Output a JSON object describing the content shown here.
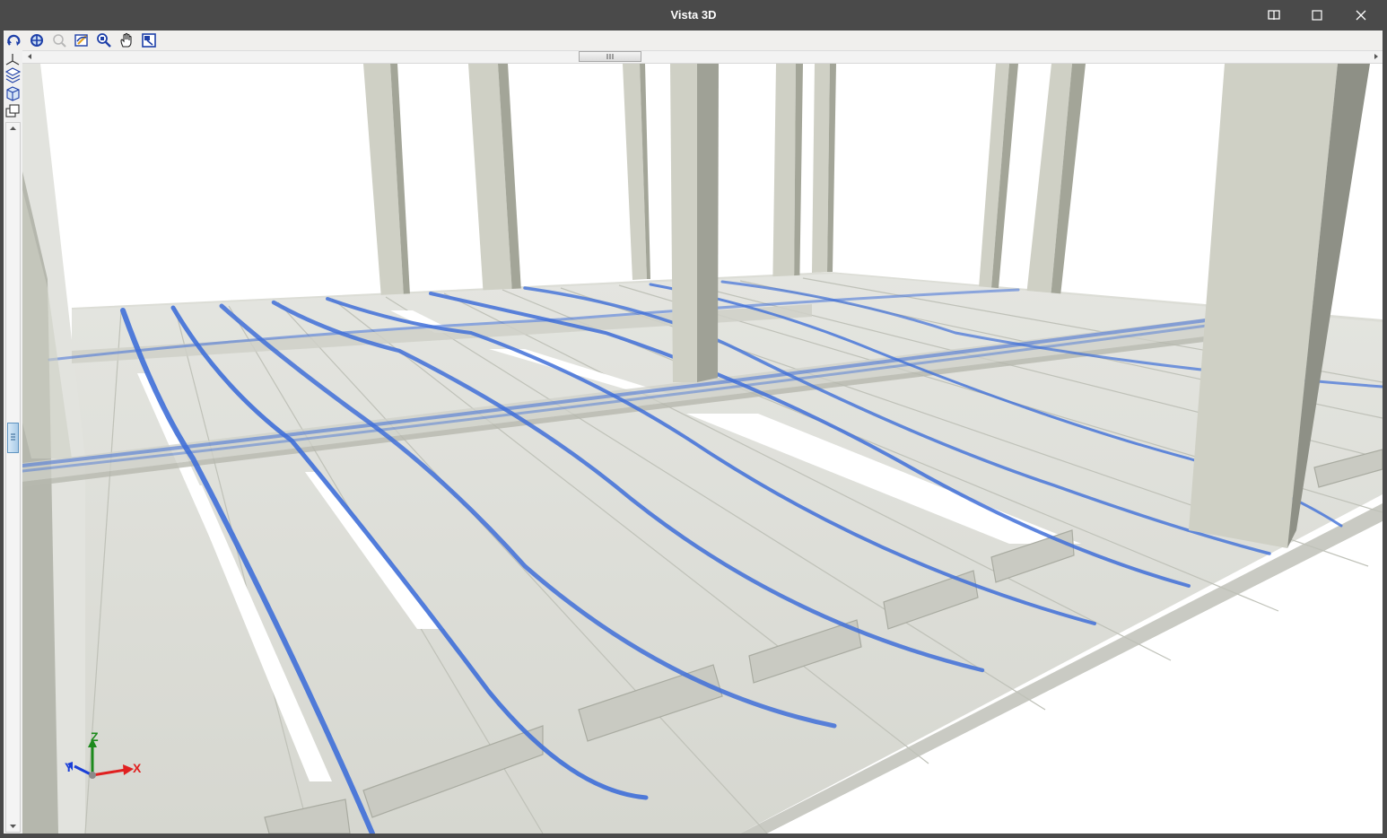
{
  "window": {
    "title": "Vista 3D"
  },
  "window_buttons": [
    "book-icon",
    "maximize-icon",
    "close-icon"
  ],
  "toolbar": {
    "tools": [
      "rotate-icon",
      "zoom-extents-icon",
      "zoom-previous-icon",
      "redraw-icon",
      "zoom-window-icon",
      "pan-hand-icon",
      "view-options-icon"
    ]
  },
  "left_tools": [
    "axes-icon",
    "layers-icon",
    "cube-icon",
    "views-icon"
  ],
  "axes": {
    "x": "X",
    "y": "Y",
    "z": "Z"
  },
  "colors": {
    "titlebar": "#4a4a4a",
    "tendon": "#3f6fd8",
    "concrete_light": "#e3e4df",
    "concrete_dark": "#b9bbb2",
    "column_front": "#cfd0c5",
    "column_side": "#9fa196",
    "axis_x": "#e02020",
    "axis_y": "#1a3fd8",
    "axis_z": "#1c8a1c"
  }
}
